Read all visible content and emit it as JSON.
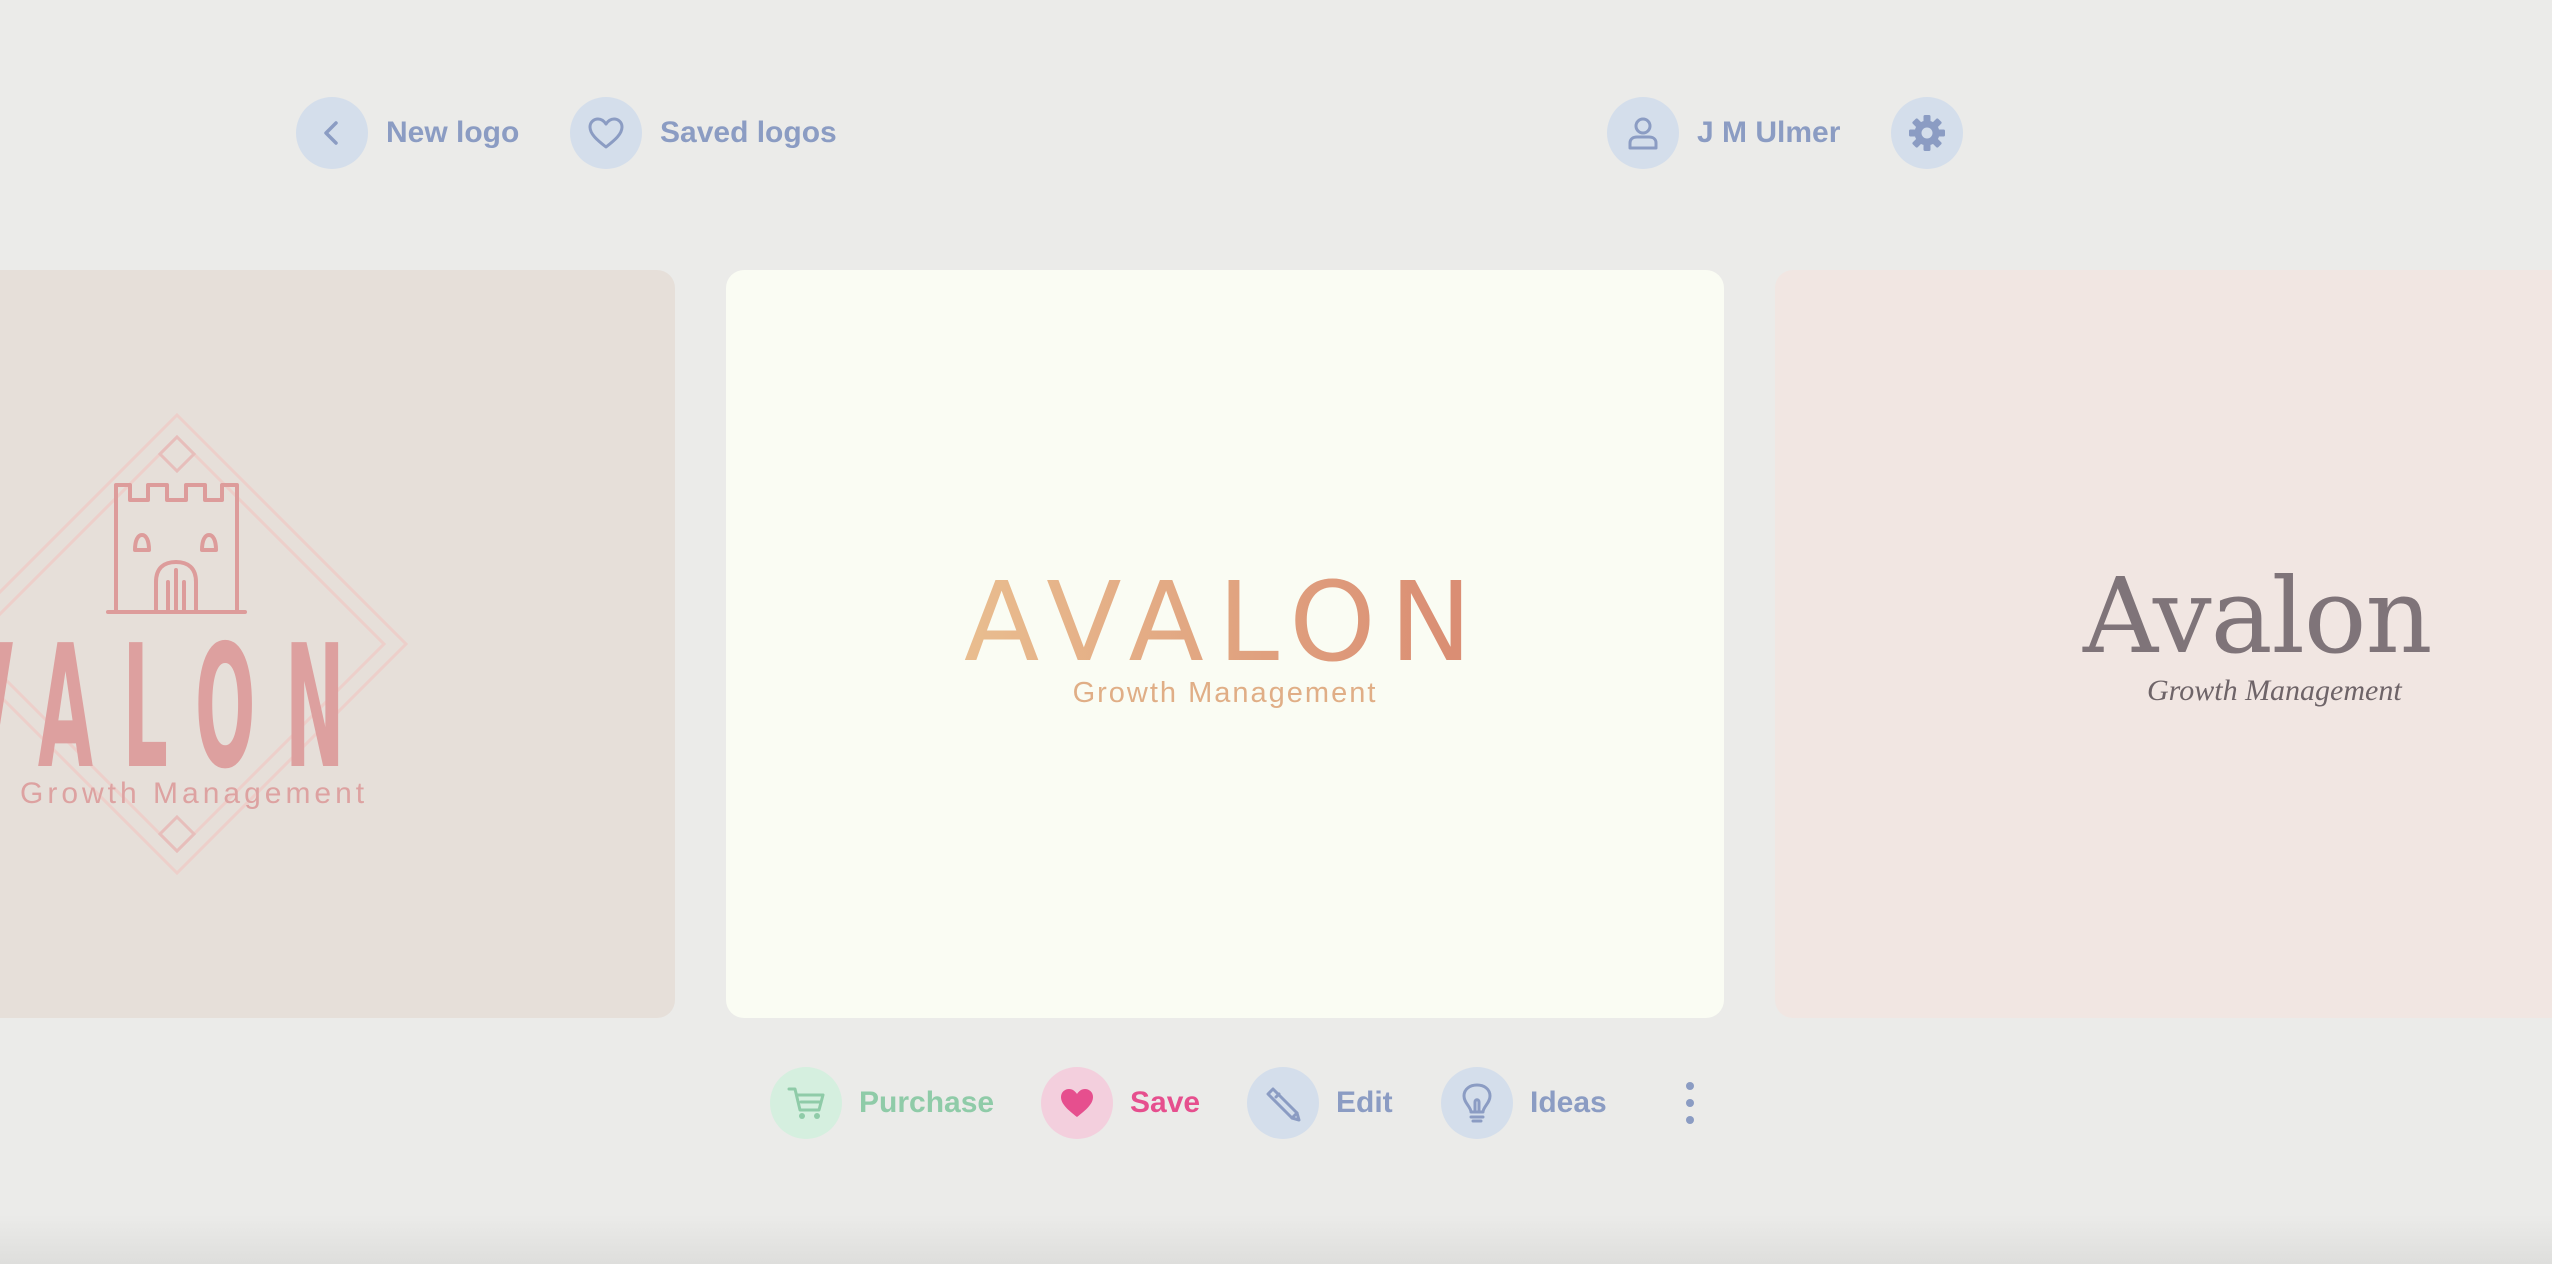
{
  "nav": {
    "new_logo": "New logo",
    "saved_logos": "Saved logos",
    "user_name": "J M Ulmer"
  },
  "logos": {
    "left": {
      "wordmark": "VALON",
      "tagline": "Growth Management"
    },
    "center": {
      "wordmark": "AVALON",
      "tagline": "Growth Management"
    },
    "right": {
      "wordmark": "Avalon",
      "tagline": "Growth Management"
    }
  },
  "actions": {
    "purchase": "Purchase",
    "save": "Save",
    "edit": "Edit",
    "ideas": "Ideas"
  },
  "colors": {
    "nav_text": "#8b9cc3",
    "nav_circle": "#d4deeb",
    "purchase": "#8fcba8",
    "save": "#e64f8e",
    "background": "#ebebe9"
  },
  "icons": {
    "new_logo": "chevron-left-icon",
    "saved_logos": "heart-outline-icon",
    "user": "user-icon",
    "settings": "gear-icon",
    "purchase": "cart-icon",
    "save": "heart-filled-icon",
    "edit": "pencil-icon",
    "ideas": "lightbulb-icon",
    "more": "more-vertical-icon"
  }
}
